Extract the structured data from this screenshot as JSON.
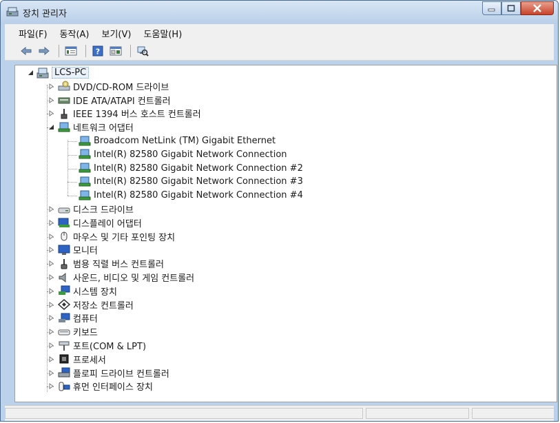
{
  "window": {
    "title": "장치 관리자"
  },
  "menu": [
    "파일(F)",
    "동작(A)",
    "보기(V)",
    "도움말(H)"
  ],
  "toolbar": {
    "buttons": [
      "back-icon",
      "forward-icon",
      "properties-icon",
      "help-icon",
      "view-icon",
      "scan-hardware-icon"
    ]
  },
  "tree": {
    "root": {
      "label": "LCS-PC",
      "icon": "computer-icon",
      "expanded": true
    },
    "categories": [
      {
        "label": "DVD/CD-ROM 드라이브",
        "icon": "dvd-drive-icon",
        "expanded": false
      },
      {
        "label": "IDE ATA/ATAPI 컨트롤러",
        "icon": "ide-controller-icon",
        "expanded": false
      },
      {
        "label": "IEEE 1394 버스 호스트 컨트롤러",
        "icon": "ieee1394-icon",
        "expanded": false
      },
      {
        "label": "네트워크 어댑터",
        "icon": "network-adapter-icon",
        "expanded": true,
        "children": [
          "Broadcom NetLink (TM) Gigabit Ethernet",
          "Intel(R) 82580 Gigabit Network Connection",
          "Intel(R) 82580 Gigabit Network Connection #2",
          "Intel(R) 82580 Gigabit Network Connection #3",
          "Intel(R) 82580 Gigabit Network Connection #4"
        ]
      },
      {
        "label": "디스크 드라이브",
        "icon": "disk-drive-icon",
        "expanded": false
      },
      {
        "label": "디스플레이 어댑터",
        "icon": "display-adapter-icon",
        "expanded": false
      },
      {
        "label": "마우스 및 기타 포인팅 장치",
        "icon": "mouse-icon",
        "expanded": false
      },
      {
        "label": "모니터",
        "icon": "monitor-icon",
        "expanded": false
      },
      {
        "label": "범용 직렬 버스 컨트롤러",
        "icon": "usb-icon",
        "expanded": false
      },
      {
        "label": "사운드, 비디오 및 게임 컨트롤러",
        "icon": "speaker-icon",
        "expanded": false
      },
      {
        "label": "시스템 장치",
        "icon": "system-device-icon",
        "expanded": false
      },
      {
        "label": "저장소 컨트롤러",
        "icon": "storage-controller-icon",
        "expanded": false
      },
      {
        "label": "컴퓨터",
        "icon": "computer-monitor-icon",
        "expanded": false
      },
      {
        "label": "키보드",
        "icon": "keyboard-icon",
        "expanded": false
      },
      {
        "label": "포트(COM & LPT)",
        "icon": "port-icon",
        "expanded": false
      },
      {
        "label": "프로세서",
        "icon": "processor-icon",
        "expanded": false
      },
      {
        "label": "플로피 드라이브 컨트롤러",
        "icon": "floppy-controller-icon",
        "expanded": false
      },
      {
        "label": "휴먼 인터페이스 장치",
        "icon": "hid-icon",
        "expanded": false
      }
    ]
  }
}
